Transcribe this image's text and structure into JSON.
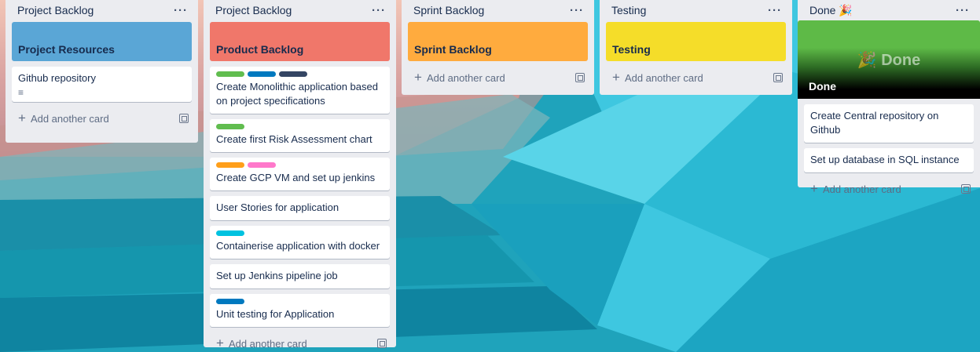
{
  "lists": [
    {
      "title": "Project Backlog",
      "cover": {
        "title": "Project Resources",
        "color": "#5aa6d6",
        "text_color": "#172b4d"
      },
      "cards": [
        {
          "text": "Github repository",
          "has_description": true
        }
      ],
      "add_label": "Add another card"
    },
    {
      "title": "Project Backlog",
      "cover": {
        "title": "Product Backlog",
        "color": "#f0776a",
        "text_color": "#172b4d"
      },
      "cards": [
        {
          "text": "Create Monolithic application based on project specifications",
          "labels": [
            "#61bd4f",
            "#0079bf",
            "#344563"
          ]
        },
        {
          "text": "Create first Risk Assessment chart",
          "labels": [
            "#61bd4f"
          ]
        },
        {
          "text": "Create GCP VM and set up jenkins",
          "labels": [
            "#ff9f1a",
            "#ff78cb"
          ]
        },
        {
          "text": "User Stories for application"
        },
        {
          "text": "Containerise application with docker",
          "labels": [
            "#00c2e0"
          ]
        },
        {
          "text": "Set up Jenkins pipeline job"
        },
        {
          "text": "Unit testing for Application",
          "labels": [
            "#0079bf"
          ]
        }
      ],
      "add_label": "Add another card"
    },
    {
      "title": "Sprint Backlog",
      "cover": {
        "title": "Sprint Backlog",
        "color": "#ffab3e",
        "text_color": "#172b4d"
      },
      "cards": [],
      "add_label": "Add another card"
    },
    {
      "title": "Testing",
      "cover": {
        "title": "Testing",
        "color": "#f5dd29",
        "text_color": "#172b4d"
      },
      "cards": [],
      "add_label": "Add another card"
    },
    {
      "title": "Done 🎉",
      "cover_image": {
        "big_text": "🎉 Done",
        "title": "Done"
      },
      "cards": [
        {
          "text": "Create Central repository on Github"
        },
        {
          "text": "Set up database in SQL instance"
        }
      ],
      "add_label": "Add another card"
    }
  ],
  "icons": {
    "menu": "···",
    "plus": "+",
    "description": "≡"
  }
}
